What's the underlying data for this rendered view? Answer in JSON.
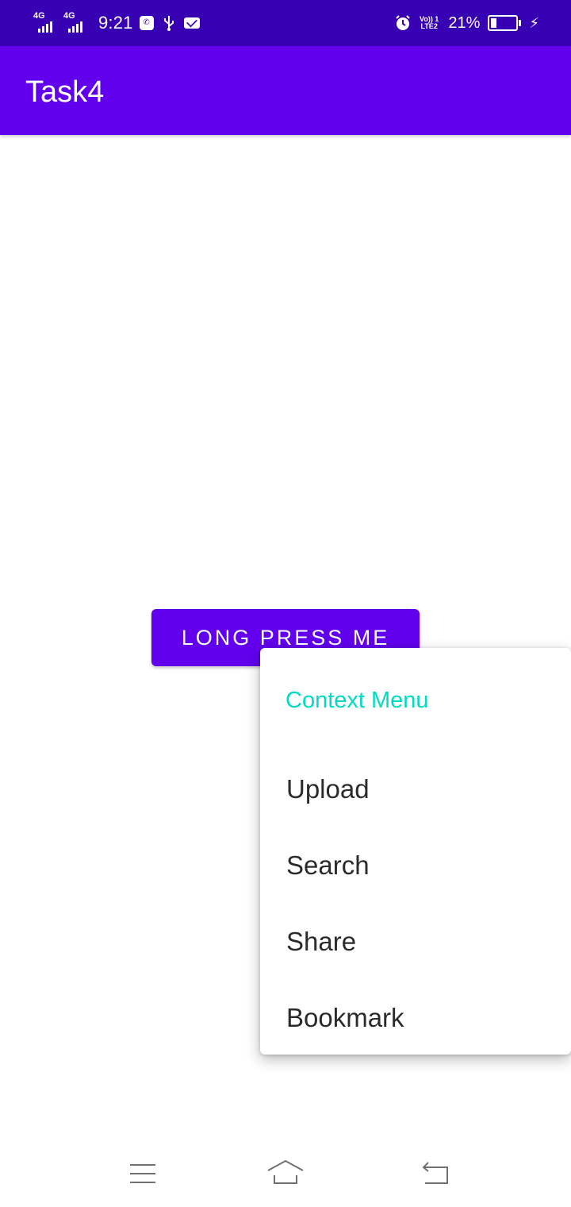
{
  "status_bar": {
    "signal_1_label": "4G",
    "signal_2_label": "4G",
    "time": "9:21",
    "volte_label_top": "Vo)) 1",
    "volte_label_bottom": "LTE2",
    "battery_percent": "21%",
    "icons": [
      "signal-icon",
      "signal-icon",
      "app-notification-icon",
      "usb-icon",
      "mail-icon",
      "alarm-icon",
      "volte-icon",
      "battery-icon",
      "charging-icon"
    ]
  },
  "app_bar": {
    "title": "Task4"
  },
  "main": {
    "button_label": "LONG PRESS ME"
  },
  "context_menu": {
    "header": "Context Menu",
    "items": [
      {
        "label": "Upload"
      },
      {
        "label": "Search"
      },
      {
        "label": "Share"
      },
      {
        "label": "Bookmark"
      }
    ]
  },
  "navigation_bar": {
    "icons": [
      "menu-icon",
      "home-icon",
      "back-icon"
    ]
  },
  "colors": {
    "status_bar": "#3700b3",
    "primary": "#6200ee",
    "menu_header": "#03dac5",
    "menu_text": "#2b2b2b"
  }
}
